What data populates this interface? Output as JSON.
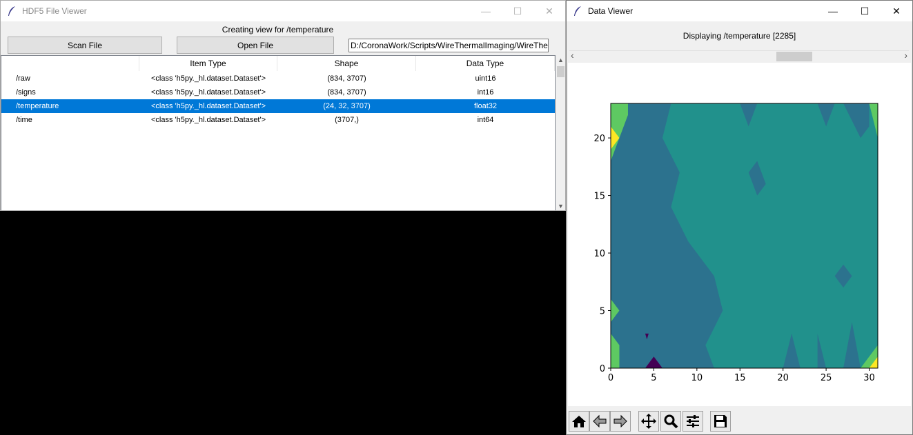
{
  "hdf5_window": {
    "title": "HDF5 File Viewer",
    "status": "Creating view for /temperature",
    "scan_label": "Scan File",
    "open_label": "Open File",
    "path_value": "D:/CoronaWork/Scripts/WireThermalImaging/WireThe",
    "columns": [
      "",
      "Item Type",
      "Shape",
      "Data Type"
    ],
    "rows": [
      {
        "name": "/raw",
        "type": "<class 'h5py._hl.dataset.Dataset'>",
        "shape": "(834, 3707)",
        "dtype": "uint16",
        "selected": false
      },
      {
        "name": "/signs",
        "type": "<class 'h5py._hl.dataset.Dataset'>",
        "shape": "(834, 3707)",
        "dtype": "int16",
        "selected": false
      },
      {
        "name": "/temperature",
        "type": "<class 'h5py._hl.dataset.Dataset'>",
        "shape": "(24, 32, 3707)",
        "dtype": "float32",
        "selected": true
      },
      {
        "name": "/time",
        "type": "<class 'h5py._hl.dataset.Dataset'>",
        "shape": "(3707,)",
        "dtype": "int64",
        "selected": false
      }
    ]
  },
  "data_window": {
    "title": "Data Viewer",
    "status": "Displaying /temperature [2285]",
    "scroll_left": "‹",
    "scroll_right": "›"
  },
  "chart_data": {
    "type": "contour",
    "title": "",
    "xlabel": "",
    "ylabel": "",
    "xlim": [
      0,
      31
    ],
    "ylim": [
      0,
      23
    ],
    "xticks": [
      0,
      5,
      10,
      15,
      20,
      25,
      30
    ],
    "yticks": [
      0,
      5,
      10,
      15,
      20
    ],
    "colormap": "viridis",
    "levels": [
      "#440154",
      "#3b528b",
      "#2c728e",
      "#21918c",
      "#5ec962",
      "#fde725"
    ],
    "description_regions": [
      {
        "level": 2,
        "x": [
          0,
          13
        ],
        "note": "dark blue band on left"
      },
      {
        "level": 3,
        "x": [
          10,
          31
        ],
        "note": "teal majority on right"
      },
      {
        "level": 4,
        "x": [
          0,
          1
        ],
        "note": "green edge spots"
      },
      {
        "level": 5,
        "x": [
          0,
          1
        ],
        "note": "yellow spots at y≈20 and y≈0 right corner"
      }
    ]
  },
  "toolbar": {
    "icons": [
      "home-icon",
      "back-icon",
      "forward-icon",
      "pan-icon",
      "zoom-icon",
      "configure-icon",
      "save-icon"
    ]
  },
  "background_colors": {
    "desktop": "#000000",
    "selection": "#0078d7"
  }
}
